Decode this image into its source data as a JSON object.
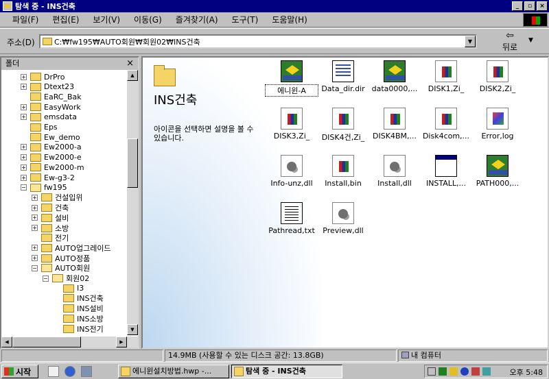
{
  "window": {
    "title": "탐색 중 - INS건축"
  },
  "menu": [
    "파일(F)",
    "편집(E)",
    "보기(V)",
    "이동(G)",
    "즐겨찾기(A)",
    "도구(T)",
    "도움말(H)"
  ],
  "address": {
    "label": "주소(D)",
    "value": "C:₩fw195₩AUTO회원₩회원02₩INS건축"
  },
  "toolbar": {
    "back_label": "뒤로"
  },
  "tree_pane": {
    "header": "폴더"
  },
  "tree": [
    {
      "label": "DrPro",
      "exp": "+"
    },
    {
      "label": "Dtext23",
      "exp": "+"
    },
    {
      "label": "EaRC_Bak",
      "exp": ""
    },
    {
      "label": "EasyWork",
      "exp": "+"
    },
    {
      "label": "emsdata",
      "exp": "+"
    },
    {
      "label": "Eps",
      "exp": ""
    },
    {
      "label": "Ew_demo",
      "exp": ""
    },
    {
      "label": "Ew2000-a",
      "exp": "+"
    },
    {
      "label": "Ew2000-e",
      "exp": "+"
    },
    {
      "label": "Ew2000-m",
      "exp": "+"
    },
    {
      "label": "Ew-g3-2",
      "exp": "+"
    },
    {
      "label": "fw195",
      "exp": "-"
    },
    {
      "label": "건설입위",
      "exp": "+"
    },
    {
      "label": "건축",
      "exp": "+"
    },
    {
      "label": "설비",
      "exp": "+"
    },
    {
      "label": "소방",
      "exp": "+"
    },
    {
      "label": "전기",
      "exp": ""
    },
    {
      "label": "AUTO업그레이드",
      "exp": "+"
    },
    {
      "label": "AUTO정품",
      "exp": "+"
    },
    {
      "label": "AUTO회원",
      "exp": "-"
    },
    {
      "label": "회원02",
      "exp": "-"
    },
    {
      "label": "I3",
      "exp": ""
    },
    {
      "label": "INS건축",
      "exp": ""
    },
    {
      "label": "INS설비",
      "exp": ""
    },
    {
      "label": "INS소방",
      "exp": ""
    },
    {
      "label": "INS전기",
      "exp": ""
    }
  ],
  "folder_view": {
    "title": "INS건축",
    "description": "아이콘을 선택하면 설명을 볼 수 있습니다."
  },
  "files": [
    {
      "label": "에니윈-A",
      "icon": "exe-app-icon",
      "selected": true
    },
    {
      "label": "Data_dir.dir",
      "icon": "document-icon"
    },
    {
      "label": "data0000,...",
      "icon": "exe-app-icon"
    },
    {
      "label": "DISK1,Zi_",
      "icon": "zip-icon"
    },
    {
      "label": "DISK2,Zi_",
      "icon": "zip-icon"
    },
    {
      "label": "DISK3,Zi_",
      "icon": "zip-icon"
    },
    {
      "label": "DISK4건,Zi_",
      "icon": "zip-icon"
    },
    {
      "label": "DISK4BM,...",
      "icon": "zip-icon"
    },
    {
      "label": "Disk4com,...",
      "icon": "zip-icon"
    },
    {
      "label": "Error,log",
      "icon": "log-icon"
    },
    {
      "label": "Info-unz,dll",
      "icon": "dll-icon"
    },
    {
      "label": "Install,bin",
      "icon": "zip-icon"
    },
    {
      "label": "Install,dll",
      "icon": "dll-icon"
    },
    {
      "label": "INSTALL,...",
      "icon": "window-icon"
    },
    {
      "label": "PATH000,...",
      "icon": "exe-app-icon"
    },
    {
      "label": "Pathread,txt",
      "icon": "text-icon"
    },
    {
      "label": "Preview,dll",
      "icon": "dll-icon"
    }
  ],
  "status": {
    "left": "",
    "space": "14.9MB (사용할 수 있는 디스크 공간: 13.8GB)",
    "location": "내 컴퓨터"
  },
  "taskbar": {
    "start_label": "시작",
    "tasks": [
      {
        "label": "에니윈설치방법.hwp -..."
      },
      {
        "label": "탐색 중 - INS건축"
      }
    ],
    "clock": "오후 5:48"
  }
}
